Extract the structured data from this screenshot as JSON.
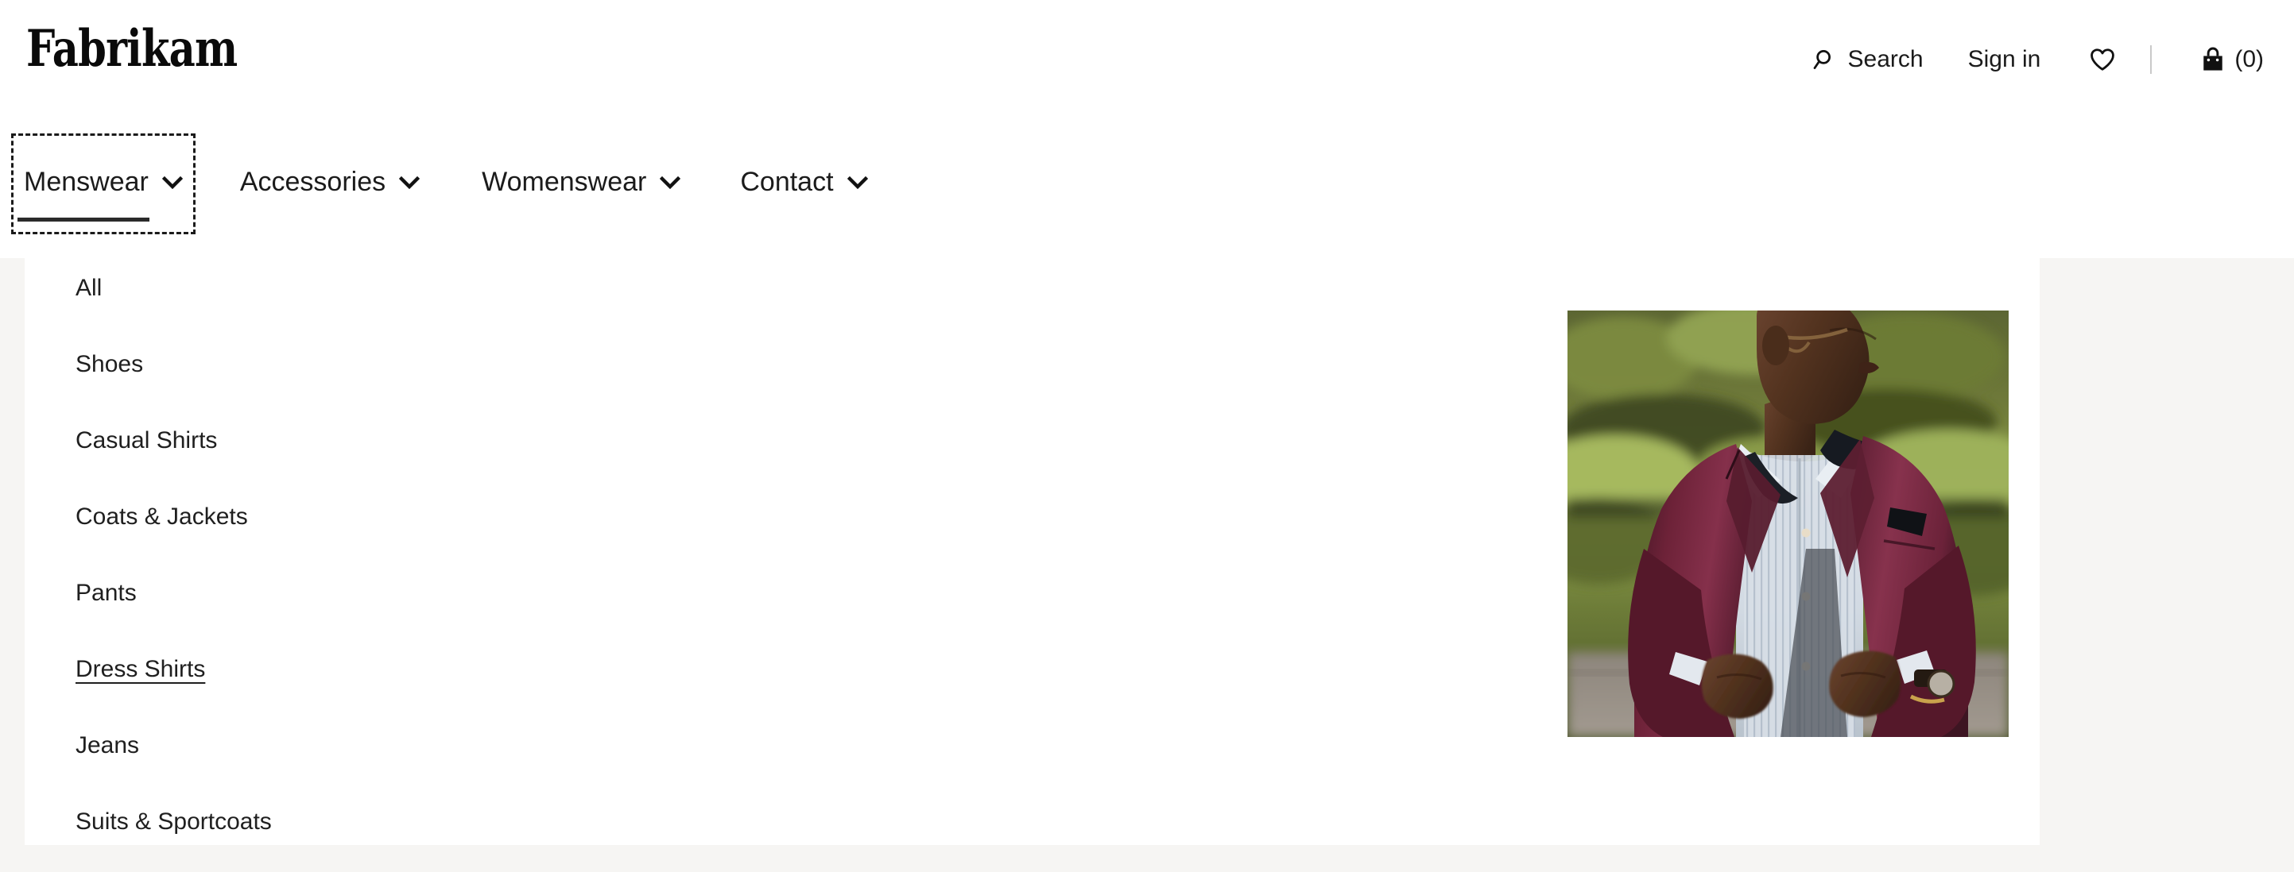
{
  "brand": {
    "name": "Fabrikam"
  },
  "header": {
    "search": {
      "label": "Search",
      "icon": "search-icon"
    },
    "signin": {
      "label": "Sign in"
    },
    "wishlist": {
      "icon": "heart-icon"
    },
    "cart": {
      "icon": "shopping-bag-icon",
      "count_label": "(0)"
    }
  },
  "nav": {
    "items": [
      {
        "label": "Menswear",
        "icon": "chevron-down-icon",
        "active": true,
        "focused": true
      },
      {
        "label": "Accessories",
        "icon": "chevron-down-icon",
        "active": false,
        "focused": false
      },
      {
        "label": "Womenswear",
        "icon": "chevron-down-icon",
        "active": false,
        "focused": false
      },
      {
        "label": "Contact",
        "icon": "chevron-down-icon",
        "active": false,
        "focused": false
      }
    ]
  },
  "dropdown": {
    "open_for": "Menswear",
    "items": [
      {
        "label": "All",
        "hovered": false
      },
      {
        "label": "Shoes",
        "hovered": false
      },
      {
        "label": "Casual Shirts",
        "hovered": false
      },
      {
        "label": "Coats & Jackets",
        "hovered": false
      },
      {
        "label": "Pants",
        "hovered": false
      },
      {
        "label": "Dress Shirts",
        "hovered": true
      },
      {
        "label": "Jeans",
        "hovered": false
      },
      {
        "label": "Suits & Sportcoats",
        "hovered": false
      }
    ],
    "promo_image_alt": "Man in burgundy blazer and light striped dress shirt outdoors"
  },
  "colors": {
    "page_background": "#f6f5f3",
    "panel_background": "#ffffff",
    "text": "#1b1b1b",
    "divider": "#c9c9c9",
    "active_bar": "#2a2a2a"
  }
}
